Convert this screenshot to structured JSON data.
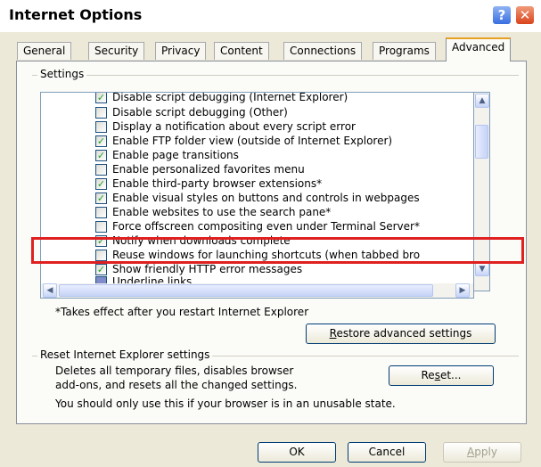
{
  "window": {
    "title": "Internet Options",
    "help_glyph": "?",
    "close_glyph": "✕"
  },
  "tabs": [
    {
      "label": "General"
    },
    {
      "label": "Security"
    },
    {
      "label": "Privacy"
    },
    {
      "label": "Content"
    },
    {
      "label": "Connections"
    },
    {
      "label": "Programs"
    },
    {
      "label": "Advanced",
      "active": true
    }
  ],
  "settings": {
    "group_title": "Settings",
    "items": [
      {
        "label": "Disable script debugging (Internet Explorer)",
        "checked": true
      },
      {
        "label": "Disable script debugging (Other)",
        "checked": false
      },
      {
        "label": "Display a notification about every script error",
        "checked": false
      },
      {
        "label": "Enable FTP folder view (outside of Internet Explorer)",
        "checked": true
      },
      {
        "label": "Enable page transitions",
        "checked": true
      },
      {
        "label": "Enable personalized favorites menu",
        "checked": false
      },
      {
        "label": "Enable third-party browser extensions*",
        "checked": true
      },
      {
        "label": "Enable visual styles on buttons and controls in webpages",
        "checked": true
      },
      {
        "label": "Enable websites to use the search pane*",
        "checked": false
      },
      {
        "label": "Force offscreen compositing even under Terminal Server*",
        "checked": false
      },
      {
        "label": "Notify when downloads complete",
        "checked": true
      },
      {
        "label": "Reuse windows for launching shortcuts (when tabbed bro",
        "checked": false
      },
      {
        "label": "Show friendly HTTP error messages",
        "checked": true
      },
      {
        "label": "Underline links",
        "checked": false
      }
    ],
    "footnote": "*Takes effect after you restart Internet Explorer",
    "restore_button": {
      "pre": "",
      "underlined": "R",
      "post": "estore advanced settings"
    }
  },
  "reset": {
    "group_title": "Reset Internet Explorer settings",
    "description_line1": "Deletes all temporary files, disables browser",
    "description_line2": "add-ons, and resets all the changed settings.",
    "button": {
      "pre": "Re",
      "underlined": "s",
      "post": "et..."
    },
    "warning": "You should only use this if your browser is in an unusable state."
  },
  "footer": {
    "ok": "OK",
    "cancel": "Cancel",
    "apply": {
      "pre": "",
      "underlined": "A",
      "post": "pply"
    }
  }
}
